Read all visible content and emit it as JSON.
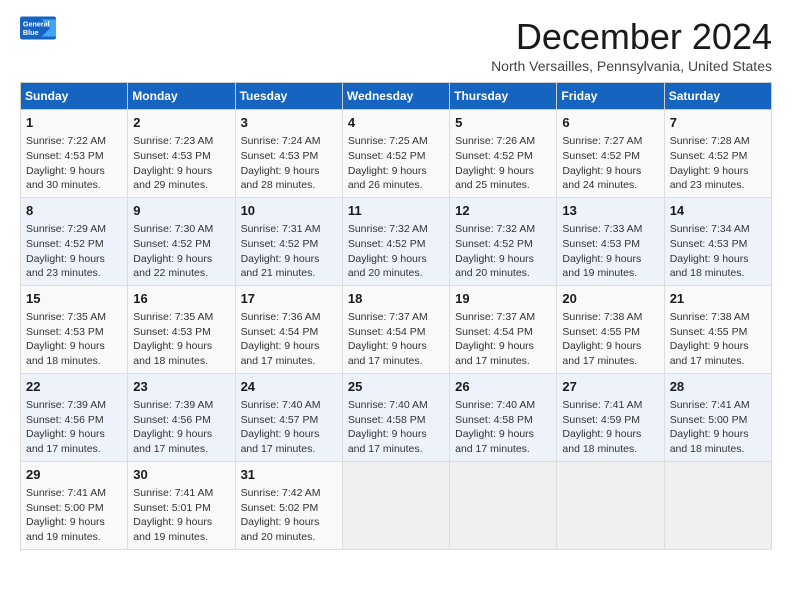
{
  "header": {
    "logo_line1": "General",
    "logo_line2": "Blue",
    "month_title": "December 2024",
    "location": "North Versailles, Pennsylvania, United States"
  },
  "days_of_week": [
    "Sunday",
    "Monday",
    "Tuesday",
    "Wednesday",
    "Thursday",
    "Friday",
    "Saturday"
  ],
  "weeks": [
    [
      {
        "num": "1",
        "info": "Sunrise: 7:22 AM\nSunset: 4:53 PM\nDaylight: 9 hours\nand 30 minutes."
      },
      {
        "num": "2",
        "info": "Sunrise: 7:23 AM\nSunset: 4:53 PM\nDaylight: 9 hours\nand 29 minutes."
      },
      {
        "num": "3",
        "info": "Sunrise: 7:24 AM\nSunset: 4:53 PM\nDaylight: 9 hours\nand 28 minutes."
      },
      {
        "num": "4",
        "info": "Sunrise: 7:25 AM\nSunset: 4:52 PM\nDaylight: 9 hours\nand 26 minutes."
      },
      {
        "num": "5",
        "info": "Sunrise: 7:26 AM\nSunset: 4:52 PM\nDaylight: 9 hours\nand 25 minutes."
      },
      {
        "num": "6",
        "info": "Sunrise: 7:27 AM\nSunset: 4:52 PM\nDaylight: 9 hours\nand 24 minutes."
      },
      {
        "num": "7",
        "info": "Sunrise: 7:28 AM\nSunset: 4:52 PM\nDaylight: 9 hours\nand 23 minutes."
      }
    ],
    [
      {
        "num": "8",
        "info": "Sunrise: 7:29 AM\nSunset: 4:52 PM\nDaylight: 9 hours\nand 23 minutes."
      },
      {
        "num": "9",
        "info": "Sunrise: 7:30 AM\nSunset: 4:52 PM\nDaylight: 9 hours\nand 22 minutes."
      },
      {
        "num": "10",
        "info": "Sunrise: 7:31 AM\nSunset: 4:52 PM\nDaylight: 9 hours\nand 21 minutes."
      },
      {
        "num": "11",
        "info": "Sunrise: 7:32 AM\nSunset: 4:52 PM\nDaylight: 9 hours\nand 20 minutes."
      },
      {
        "num": "12",
        "info": "Sunrise: 7:32 AM\nSunset: 4:52 PM\nDaylight: 9 hours\nand 20 minutes."
      },
      {
        "num": "13",
        "info": "Sunrise: 7:33 AM\nSunset: 4:53 PM\nDaylight: 9 hours\nand 19 minutes."
      },
      {
        "num": "14",
        "info": "Sunrise: 7:34 AM\nSunset: 4:53 PM\nDaylight: 9 hours\nand 18 minutes."
      }
    ],
    [
      {
        "num": "15",
        "info": "Sunrise: 7:35 AM\nSunset: 4:53 PM\nDaylight: 9 hours\nand 18 minutes."
      },
      {
        "num": "16",
        "info": "Sunrise: 7:35 AM\nSunset: 4:53 PM\nDaylight: 9 hours\nand 18 minutes."
      },
      {
        "num": "17",
        "info": "Sunrise: 7:36 AM\nSunset: 4:54 PM\nDaylight: 9 hours\nand 17 minutes."
      },
      {
        "num": "18",
        "info": "Sunrise: 7:37 AM\nSunset: 4:54 PM\nDaylight: 9 hours\nand 17 minutes."
      },
      {
        "num": "19",
        "info": "Sunrise: 7:37 AM\nSunset: 4:54 PM\nDaylight: 9 hours\nand 17 minutes."
      },
      {
        "num": "20",
        "info": "Sunrise: 7:38 AM\nSunset: 4:55 PM\nDaylight: 9 hours\nand 17 minutes."
      },
      {
        "num": "21",
        "info": "Sunrise: 7:38 AM\nSunset: 4:55 PM\nDaylight: 9 hours\nand 17 minutes."
      }
    ],
    [
      {
        "num": "22",
        "info": "Sunrise: 7:39 AM\nSunset: 4:56 PM\nDaylight: 9 hours\nand 17 minutes."
      },
      {
        "num": "23",
        "info": "Sunrise: 7:39 AM\nSunset: 4:56 PM\nDaylight: 9 hours\nand 17 minutes."
      },
      {
        "num": "24",
        "info": "Sunrise: 7:40 AM\nSunset: 4:57 PM\nDaylight: 9 hours\nand 17 minutes."
      },
      {
        "num": "25",
        "info": "Sunrise: 7:40 AM\nSunset: 4:58 PM\nDaylight: 9 hours\nand 17 minutes."
      },
      {
        "num": "26",
        "info": "Sunrise: 7:40 AM\nSunset: 4:58 PM\nDaylight: 9 hours\nand 17 minutes."
      },
      {
        "num": "27",
        "info": "Sunrise: 7:41 AM\nSunset: 4:59 PM\nDaylight: 9 hours\nand 18 minutes."
      },
      {
        "num": "28",
        "info": "Sunrise: 7:41 AM\nSunset: 5:00 PM\nDaylight: 9 hours\nand 18 minutes."
      }
    ],
    [
      {
        "num": "29",
        "info": "Sunrise: 7:41 AM\nSunset: 5:00 PM\nDaylight: 9 hours\nand 19 minutes."
      },
      {
        "num": "30",
        "info": "Sunrise: 7:41 AM\nSunset: 5:01 PM\nDaylight: 9 hours\nand 19 minutes."
      },
      {
        "num": "31",
        "info": "Sunrise: 7:42 AM\nSunset: 5:02 PM\nDaylight: 9 hours\nand 20 minutes."
      },
      {
        "num": "",
        "info": ""
      },
      {
        "num": "",
        "info": ""
      },
      {
        "num": "",
        "info": ""
      },
      {
        "num": "",
        "info": ""
      }
    ]
  ]
}
